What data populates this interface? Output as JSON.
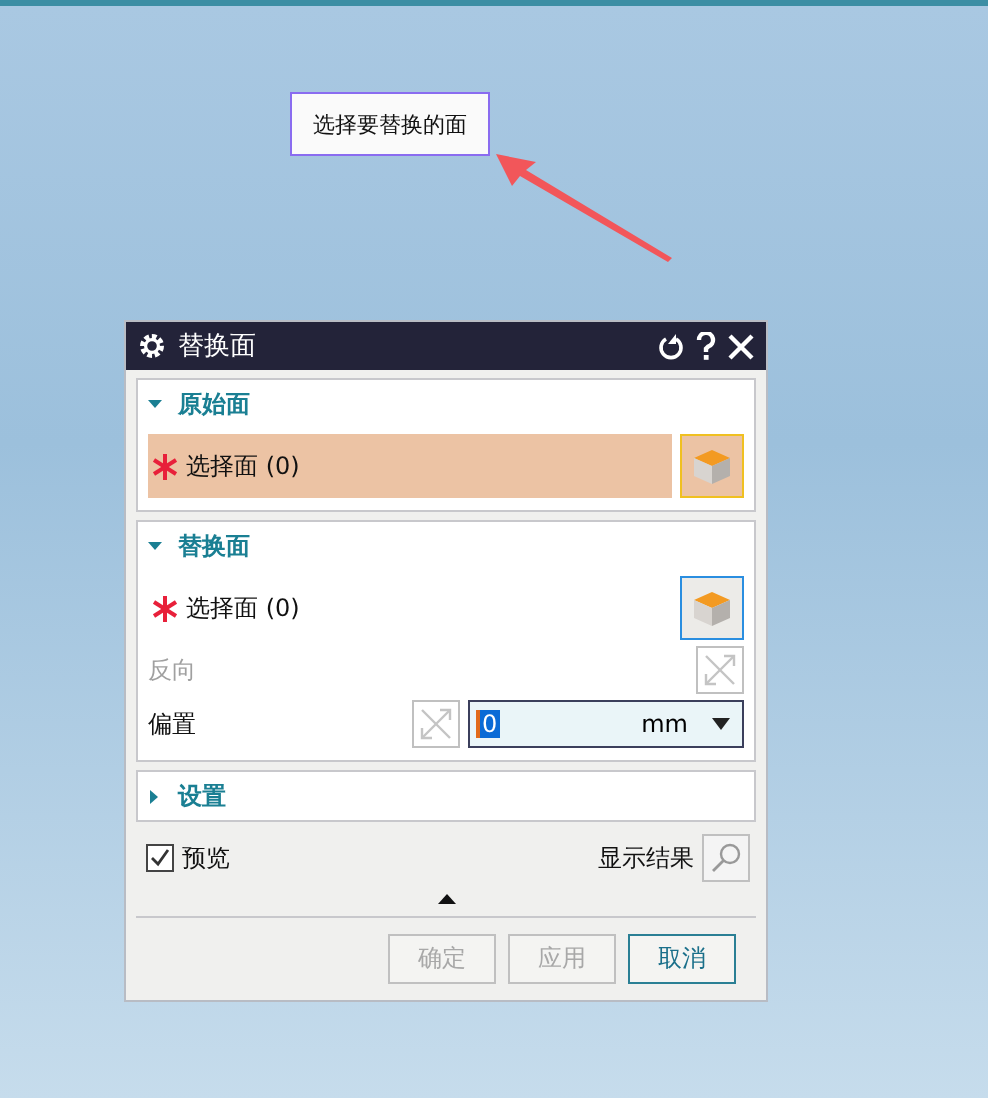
{
  "tooltip": {
    "text": "选择要替换的面"
  },
  "dialog": {
    "title": "替换面",
    "sections": [
      {
        "title": "原始面",
        "expanded": true,
        "rows": [
          {
            "kind": "select",
            "label": "选择面 (0)",
            "required": true,
            "active": true
          }
        ]
      },
      {
        "title": "替换面",
        "expanded": true,
        "rows": [
          {
            "kind": "select",
            "label": "选择面 (0)",
            "required": true,
            "active": false
          },
          {
            "kind": "reverse",
            "label": "反向",
            "disabled": true
          },
          {
            "kind": "offset",
            "label": "偏置",
            "value": "0",
            "unit": "mm"
          }
        ]
      },
      {
        "title": "设置",
        "expanded": false
      }
    ],
    "preview": {
      "label": "预览",
      "checked": true
    },
    "show_result": {
      "label": "显示结果"
    },
    "buttons": [
      {
        "label": "确定",
        "disabled": true
      },
      {
        "label": "应用",
        "disabled": true
      },
      {
        "label": "取消",
        "disabled": false
      }
    ]
  }
}
